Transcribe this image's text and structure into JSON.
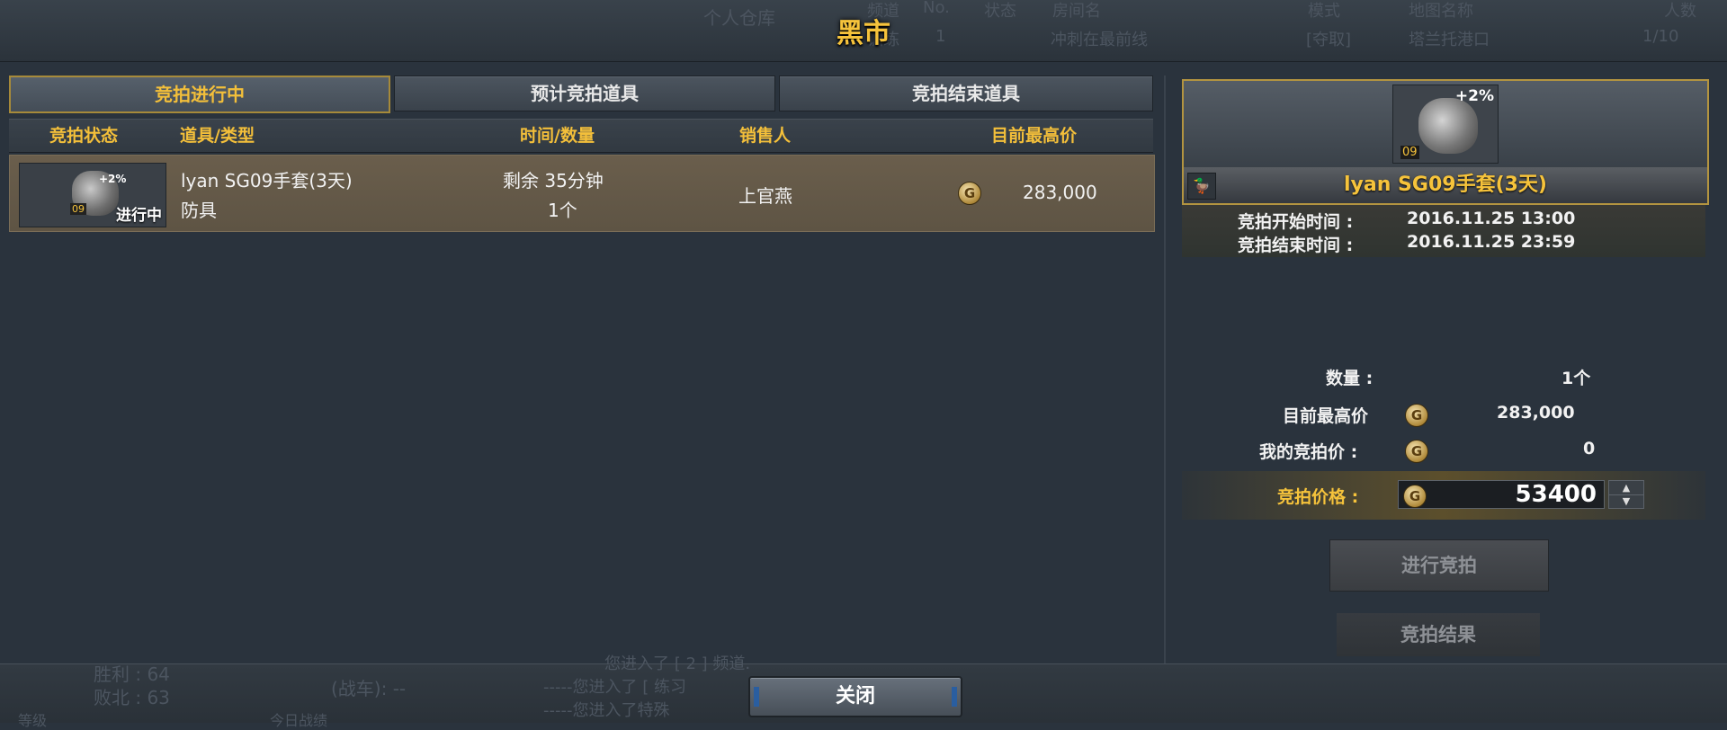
{
  "window": {
    "title": "黑市"
  },
  "background": {
    "top_labels": [
      "个人仓库",
      "频道",
      "No.",
      "状态",
      "房间名",
      "模式",
      "地图名称",
      "人数"
    ],
    "top_row": [
      "训练",
      "1",
      "冲刺在最前线",
      "[夺取]",
      "塔兰托港口",
      "1/10"
    ],
    "bottom_left": {
      "wins": "胜利 : 64",
      "losses": "败北 : 63",
      "tank": "(战车): --",
      "rank": "等级",
      "today": "今日战绩"
    },
    "chat": [
      "您进入了 [ 2 ] 频道.",
      "-----您进入了 [ 练习",
      "-----您进入了特殊"
    ]
  },
  "tabs": [
    {
      "label": "竞拍进行中",
      "active": true
    },
    {
      "label": "预计竞拍道具",
      "active": false
    },
    {
      "label": "竞拍结束道具",
      "active": false
    }
  ],
  "columns": {
    "status": "竞拍状态",
    "item_type": "道具/类型",
    "time_qty": "时间/数量",
    "seller": "销售人",
    "top_price": "目前最高价"
  },
  "rows": [
    {
      "thumb_level": "09",
      "thumb_bonus": "+2%",
      "status": "进行中",
      "name": "lyan SG09手套(3天)",
      "type": "防具",
      "time_left": "剩余 35分钟",
      "quantity": "1个",
      "seller": "上官燕",
      "currency_icon": "G",
      "price": "283,000"
    }
  ],
  "detail": {
    "bonus": "+2%",
    "level": "09",
    "name": "lyan SG09手套(3天)",
    "start_label": "竞拍开始时间 :",
    "start_value": "2016.11.25 13:00",
    "end_label": "竞拍结束时间 :",
    "end_value": "2016.11.25 23:59",
    "qty_label": "数量 :",
    "qty_value": "1个",
    "top_price_label": "目前最高价",
    "top_price_value": "283,000",
    "my_bid_label": "我的竞拍价 :",
    "my_bid_value": "0",
    "bid_price_label": "竞拍价格 :",
    "bid_price_value": "53400",
    "currency_icon": "G"
  },
  "buttons": {
    "bid": "进行竞拍",
    "result": "竞拍结果",
    "close": "关闭"
  },
  "colors": {
    "accent_gold": "#f6c33b",
    "panel_bg": "#2a333d",
    "row_bg": "#665a48"
  }
}
